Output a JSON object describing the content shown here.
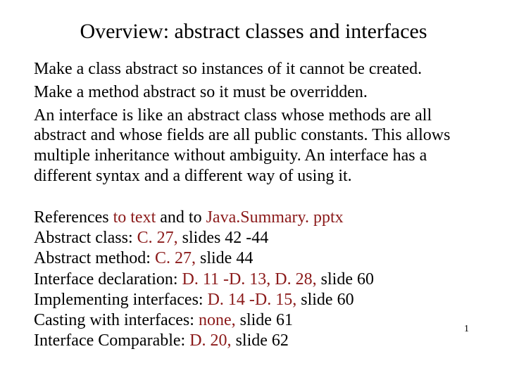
{
  "title": "Overview: abstract classes and interfaces",
  "body": {
    "p1": "Make a class abstract so instances of it cannot be created.",
    "p2": "Make a method abstract so it must be overridden.",
    "p3": "An interface is like an abstract class whose methods are all abstract and whose fields are all public constants. This allows multiple inheritance without ambiguity. An interface has a different syntax and a different way of using it."
  },
  "refs": {
    "heading_a": "References ",
    "heading_b": "to text",
    "heading_c": " and to ",
    "heading_d": "Java.Summary. pptx",
    "r1_a": "Abstract class: ",
    "r1_b": "C. 27,",
    "r1_c": "  slides 42 -44",
    "r2_a": "Abstract method: ",
    "r2_b": "C. 27,",
    "r2_c": "  slide 44",
    "r3_a": "Interface declaration: ",
    "r3_b": "D. 11 -D. 13, D. 28,",
    "r3_c": "  slide 60",
    "r4_a": "Implementing interfaces: ",
    "r4_b": "D. 14 -D. 15,",
    "r4_c": " slide 60",
    "r5_a": "Casting with interfaces:  ",
    "r5_b": "none,",
    "r5_c": "   slide 61",
    "r6_a": "Interface Comparable: ",
    "r6_b": "D. 20,",
    "r6_c": "  slide 62"
  },
  "page": "1"
}
